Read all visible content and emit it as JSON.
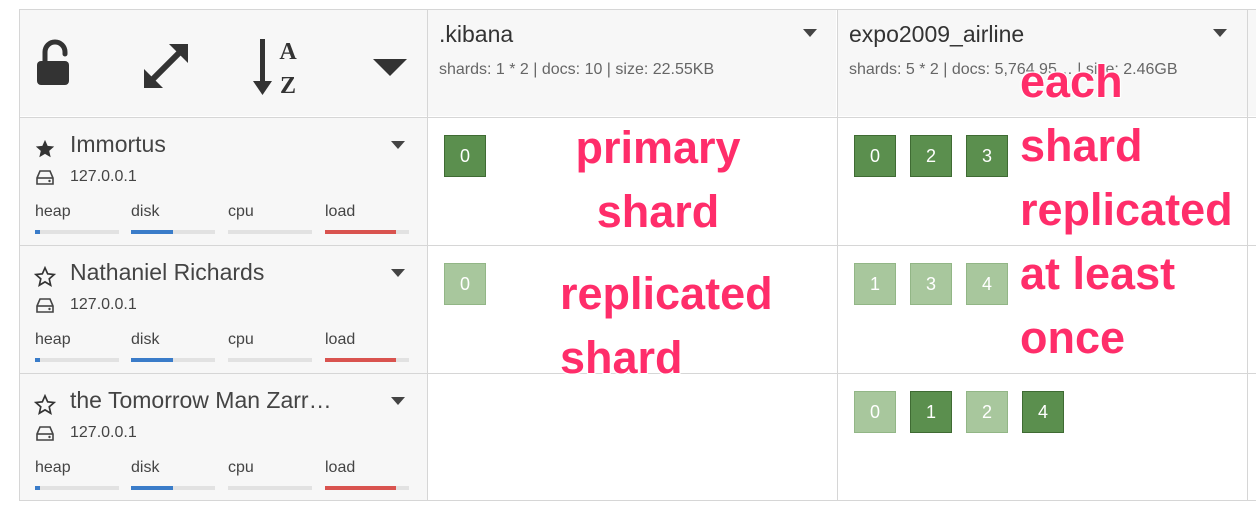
{
  "toolbar": {
    "icons": [
      "unlock-icon",
      "expand-icon",
      "sort-alpha-icon",
      "caret-down-icon"
    ]
  },
  "indices": [
    {
      "name": ".kibana",
      "stats": "shards: 1 * 2 | docs: 10 | size: 22.55KB"
    },
    {
      "name": "expo2009_airline",
      "stats": "shards: 5 * 2 | docs: 5,764,95… | size: 2.46GB"
    }
  ],
  "metric_labels": [
    "heap",
    "disk",
    "cpu",
    "load"
  ],
  "nodes": [
    {
      "name": "Immortus",
      "master": true,
      "ip": "127.0.0.1",
      "metrics": {
        "heap": 0.06,
        "disk": 0.5,
        "cpu": 0.0,
        "load": 0.85
      },
      "shards": [
        [
          "0"
        ],
        [
          "0",
          "2",
          "3"
        ]
      ]
    },
    {
      "name": "Nathaniel Richards",
      "master": false,
      "ip": "127.0.0.1",
      "metrics": {
        "heap": 0.06,
        "disk": 0.5,
        "cpu": 0.0,
        "load": 0.85
      },
      "shards": [
        [
          "0"
        ],
        [
          "1",
          "3",
          "4"
        ]
      ]
    },
    {
      "name": "the Tomorrow Man Zarr…",
      "master": false,
      "ip": "127.0.0.1",
      "metrics": {
        "heap": 0.06,
        "disk": 0.5,
        "cpu": 0.0,
        "load": 0.85
      },
      "shards": [
        [],
        [
          "0",
          "1",
          "2",
          "4"
        ]
      ]
    }
  ],
  "annotations": {
    "primary": [
      "primary",
      "shard"
    ],
    "replicated": [
      "replicated",
      "shard"
    ],
    "each": [
      "each",
      "shard",
      "replicated",
      "at least",
      "once"
    ]
  },
  "colors": {
    "primary_shard": "#5b8f4e",
    "replica_shard": "#a8c79d",
    "annotation": "#ff2d6a",
    "heap_bar": "#3a7cc9",
    "disk_bar": "#3a7cc9",
    "load_bar": "#d9534f"
  }
}
